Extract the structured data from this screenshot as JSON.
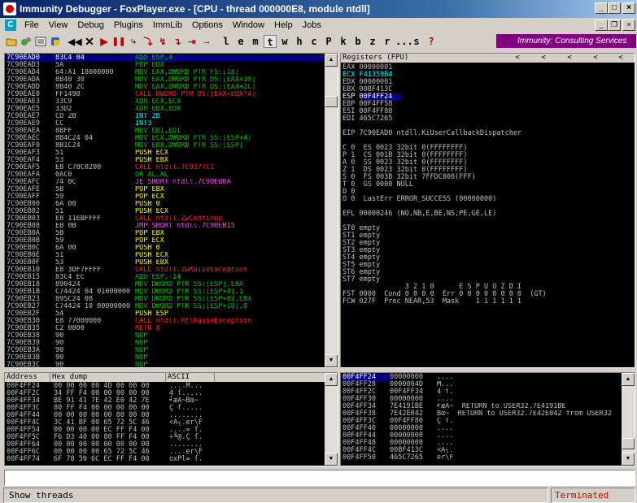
{
  "window": {
    "title": "Immunity Debugger - FoxPlayer.exe - [CPU - thread 000000E8, module ntdll]",
    "min": "_",
    "max": "□",
    "close": "×"
  },
  "mdi": {
    "min": "_",
    "restore": "❐",
    "close": "×"
  },
  "menu": [
    "File",
    "View",
    "Debug",
    "Plugins",
    "ImmLib",
    "Options",
    "Window",
    "Help",
    "Jobs"
  ],
  "menu_icon": "C",
  "toolbar_letters": [
    "l",
    "e",
    "m",
    "t",
    "w",
    "h",
    "c",
    "P",
    "k",
    "b",
    "z",
    "r",
    "...",
    "s",
    "?"
  ],
  "banner": "Immunity: Consulting Services",
  "cpu_rows": [
    {
      "a": "7C90EAD0",
      "h": "83C4 04",
      "d": "ADD ESP,4",
      "c": "grn",
      "sel": true
    },
    {
      "a": "7C90EAD3",
      "h": "5A",
      "d": "POP EDX",
      "c": "grn"
    },
    {
      "a": "7C90EAD4",
      "h": "64:A1 18000000",
      "d": "MOV EAX,DWORD PTR FS:[18]",
      "c": "grn"
    },
    {
      "a": "7C90EADA",
      "h": "8B40 30",
      "d": "MOV EAX,DWORD PTR DS:[EAX+30]",
      "c": "grn"
    },
    {
      "a": "7C90EADD",
      "h": "8B40 2C",
      "d": "MOV EAX,DWORD PTR DS:[EAX+2C]",
      "c": "grn"
    },
    {
      "a": "7C90EAE0",
      "h": "FF1490",
      "d": "CALL DWORD PTR DS:[EAX+EDX*4]",
      "c": "red"
    },
    {
      "a": "7C90EAE3",
      "h": "33C9",
      "d": "XOR ECX,ECX",
      "c": "grn"
    },
    {
      "a": "7C90EAE5",
      "h": "33D2",
      "d": "XOR EDX,EDX",
      "c": "grn"
    },
    {
      "a": "7C90EAE7",
      "h": "CD 2B",
      "d": "INT 2B",
      "c": "cyan"
    },
    {
      "a": "7C90EAE9",
      "h": "CC",
      "d": "INT3",
      "c": "cyan"
    },
    {
      "a": "7C90EAEA",
      "h": "8BFF",
      "d": "MOV EDI,EDI",
      "c": "grn"
    },
    {
      "a": "7C90EAEC",
      "h": "8B4C24 04",
      "d": "MOV ECX,DWORD PTR SS:[ESP+4]",
      "c": "grn"
    },
    {
      "a": "7C90EAF0",
      "h": "8B1C24",
      "d": "MOV EBX,DWORD PTR SS:[ESP]",
      "c": "grn"
    },
    {
      "a": "7C90EAF3",
      "h": "51",
      "d": "PUSH ECX",
      "c": "yel"
    },
    {
      "a": "7C90EAF4",
      "h": "53",
      "d": "PUSH EBX",
      "c": "yel"
    },
    {
      "a": "7C90EAF5",
      "h": "E8 C78C0200",
      "d": "CALL ntdll.7C9377C1",
      "c": "red"
    },
    {
      "a": "7C90EAFA",
      "h": "0AC0",
      "d": "OR AL,AL",
      "c": "grn"
    },
    {
      "a": "7C90EAFC",
      "h": "74 0C",
      "d": "JE SHORT ntdll.7C90EB0A",
      "c": "mag"
    },
    {
      "a": "7C90EAFE",
      "h": "5B",
      "d": "POP EBX",
      "c": "yel"
    },
    {
      "a": "7C90EAFF",
      "h": "59",
      "d": "POP ECX",
      "c": "yel"
    },
    {
      "a": "7C90EB00",
      "h": "6A 00",
      "d": "PUSH 0",
      "c": "yel"
    },
    {
      "a": "7C90EB02",
      "h": "51",
      "d": "PUSH ECX",
      "c": "yel"
    },
    {
      "a": "7C90EB03",
      "h": "E8 11EBFFFF",
      "d": "CALL ntdll.ZwContinue",
      "c": "red"
    },
    {
      "a": "7C90EB08",
      "h": "EB 0B",
      "d": "JMP SHORT ntdll.7C90EB15",
      "c": "mag"
    },
    {
      "a": "7C90EB0A",
      "h": "5B",
      "d": "POP EBX",
      "c": "yel"
    },
    {
      "a": "7C90EB0B",
      "h": "59",
      "d": "POP ECX",
      "c": "yel"
    },
    {
      "a": "7C90EB0C",
      "h": "6A 00",
      "d": "PUSH 0",
      "c": "yel"
    },
    {
      "a": "7C90EB0E",
      "h": "51",
      "d": "PUSH ECX",
      "c": "yel"
    },
    {
      "a": "7C90EB0F",
      "h": "53",
      "d": "PUSH EBX",
      "c": "yel"
    },
    {
      "a": "7C90EB10",
      "h": "E8 3DF7FFFF",
      "d": "CALL ntdll.ZwRaiseException",
      "c": "red"
    },
    {
      "a": "7C90EB15",
      "h": "83C4 EC",
      "d": "ADD ESP,-14",
      "c": "grn"
    },
    {
      "a": "7C90EB18",
      "h": "890424",
      "d": "MOV DWORD PTR SS:[ESP],EAX",
      "c": "grn"
    },
    {
      "a": "7C90EB1B",
      "h": "C74424 04 01000000",
      "d": "MOV DWORD PTR SS:[ESP+4],1",
      "c": "grn"
    },
    {
      "a": "7C90EB23",
      "h": "895C24 08",
      "d": "MOV DWORD PTR SS:[ESP+8],EBX",
      "c": "grn"
    },
    {
      "a": "7C90EB27",
      "h": "C74424 10 00000000",
      "d": "MOV DWORD PTR SS:[ESP+10],0",
      "c": "grn"
    },
    {
      "a": "7C90EB2F",
      "h": "54",
      "d": "PUSH ESP",
      "c": "yel"
    },
    {
      "a": "7C90EB30",
      "h": "E8 77000000",
      "d": "CALL ntdll.RtlRaiseException",
      "c": "red"
    },
    {
      "a": "7C90EB35",
      "h": "C2 0800",
      "d": "RETN 8",
      "c": "red"
    },
    {
      "a": "7C90EB38",
      "h": "90",
      "d": "NOP",
      "c": "grn"
    },
    {
      "a": "7C90EB39",
      "h": "90",
      "d": "NOP",
      "c": "grn"
    },
    {
      "a": "7C90EB3A",
      "h": "90",
      "d": "NOP",
      "c": "grn"
    },
    {
      "a": "7C90EB3B",
      "h": "90",
      "d": "NOP",
      "c": "grn"
    },
    {
      "a": "7C90EB3C",
      "h": "90",
      "d": "NOP",
      "c": "grn"
    },
    {
      "a": "7C90EB3D",
      "h": "90",
      "d": "NOP",
      "c": "grn"
    }
  ],
  "registers": {
    "title": "Registers (FPU)",
    "nav": [
      "<",
      "<",
      "<",
      "<",
      "<"
    ],
    "lines": [
      {
        "t": "EAX 00000001",
        "c": "gry"
      },
      {
        "t": "ECX F41359B4",
        "c": "cyan"
      },
      {
        "t": "EDX 00000001",
        "c": "gry"
      },
      {
        "t": "EBX 00BF413C",
        "c": "gry"
      },
      {
        "t": "ESP 00F4FF24",
        "c": "sel"
      },
      {
        "t": "EBP 00F4FF58",
        "c": "gry"
      },
      {
        "t": "ESI 00F4FF80",
        "c": "gry"
      },
      {
        "t": "EDI 465C7265",
        "c": "gry"
      },
      {
        "t": "",
        "c": "gry"
      },
      {
        "t": "EIP 7C90EAD0 ntdll.KiUserCallbackDispatcher",
        "c": "gry"
      },
      {
        "t": "",
        "c": "gry"
      },
      {
        "t": "C 0  ES 0023 32bit 0(FFFFFFFF)",
        "c": "gry"
      },
      {
        "t": "P 1  CS 001B 32bit 0(FFFFFFFF)",
        "c": "gry"
      },
      {
        "t": "A 0  SS 0023 32bit 0(FFFFFFFF)",
        "c": "gry"
      },
      {
        "t": "Z 1  DS 0023 32bit 0(FFFFFFFF)",
        "c": "gry"
      },
      {
        "t": "S 0  FS 003B 32bit 7FFDC000(FFF)",
        "c": "gry"
      },
      {
        "t": "T 0  GS 0000 NULL",
        "c": "gry"
      },
      {
        "t": "D 0",
        "c": "gry"
      },
      {
        "t": "O 0  LastErr ERROR_SUCCESS (00000000)",
        "c": "gry"
      },
      {
        "t": "",
        "c": "gry"
      },
      {
        "t": "EFL 00000246 (NO,NB,E,BE,NS,PE,GE,LE)",
        "c": "gry"
      },
      {
        "t": "",
        "c": "gry"
      },
      {
        "t": "ST0 empty",
        "c": "gry"
      },
      {
        "t": "ST1 empty",
        "c": "gry"
      },
      {
        "t": "ST2 empty",
        "c": "gry"
      },
      {
        "t": "ST3 empty",
        "c": "gry"
      },
      {
        "t": "ST4 empty",
        "c": "gry"
      },
      {
        "t": "ST5 empty",
        "c": "gry"
      },
      {
        "t": "ST6 empty",
        "c": "gry"
      },
      {
        "t": "ST7 empty",
        "c": "gry"
      },
      {
        "t": "               3 2 1 0      E S P U O Z D I",
        "c": "gry"
      },
      {
        "t": "FST 0000  Cond 0 0 0 0  Err 0 0 0 0 0 0 0 0  (GT)",
        "c": "gry"
      },
      {
        "t": "FCW 027F  Prec NEAR,53  Mask    1 1 1 1 1 1",
        "c": "gry"
      }
    ]
  },
  "dump": {
    "headers": [
      "Address",
      "Hex dump",
      "ASCII"
    ],
    "rows": [
      {
        "a": "00F4FF24",
        "h": "00 00 00 00 4D 00 00 00",
        "s": "....M..."
      },
      {
        "a": "00F4FF2C",
        "h": "34 FF F4 00 00 00 00 00",
        "s": "4 ſ....."
      },
      {
        "a": "00F4FF34",
        "h": "BE 91 41 7E 42 E0 42 7E",
        "s": "╛æA~Bα~"
      },
      {
        "a": "00F4FF3C",
        "h": "80 FF F4 00 00 00 00 00",
        "s": "Ç ſ....."
      },
      {
        "a": "00F4FF44",
        "h": "00 00 00 00 00 00 00 00",
        "s": "........"
      },
      {
        "a": "00F4FF4C",
        "h": "3C 41 BF 00 65 72 5C 46",
        "s": "<A┐.er\\F"
      },
      {
        "a": "00F4FF54",
        "h": "00 00 00 00 EC FF F4 00",
        "s": "....∞ ſ."
      },
      {
        "a": "00F4FF5C",
        "h": "F6 D3 40 00 80 FF F4 00",
        "s": "÷╙@.Ç ſ."
      },
      {
        "a": "00F4FF64",
        "h": "00 00 00 00 00 00 00 00",
        "s": "........"
      },
      {
        "a": "00F4FF6C",
        "h": "00 00 00 00 65 72 5C 46",
        "s": "....er\\F"
      },
      {
        "a": "00F4FF74",
        "h": "6F 78 50 6C EC FF F4 00",
        "s": "oxPl∞ ſ."
      }
    ]
  },
  "stack": {
    "rows": [
      {
        "a": "00F4FF24",
        "v": "00000000",
        "t": "....",
        "sel": true
      },
      {
        "a": "00F4FF28",
        "v": "0000004D",
        "t": "M..."
      },
      {
        "a": "00F4FF2C",
        "v": "00F4FF34",
        "t": "4 ſ."
      },
      {
        "a": "00F4FF30",
        "v": "00000000",
        "t": "...."
      },
      {
        "a": "00F4FF34",
        "v": "7E4191BE",
        "t": "╛æA~  RETURN to USER32.7E4191BE"
      },
      {
        "a": "00F4FF38",
        "v": "7E42E042",
        "t": "Bα~  RETURN to USER32.7E42E042 from USER32"
      },
      {
        "a": "00F4FF3C",
        "v": "00F4FF80",
        "t": "Ç ſ."
      },
      {
        "a": "00F4FF40",
        "v": "00000000",
        "t": "...."
      },
      {
        "a": "00F4FF44",
        "v": "00000000",
        "t": "...."
      },
      {
        "a": "00F4FF48",
        "v": "00000000",
        "t": "...."
      },
      {
        "a": "00F4FF4C",
        "v": "00BF413C",
        "t": "<A┐."
      },
      {
        "a": "00F4FF50",
        "v": "465C7265",
        "t": "er\\F"
      }
    ]
  },
  "status": {
    "left": "Show threads",
    "right": "Terminated"
  }
}
